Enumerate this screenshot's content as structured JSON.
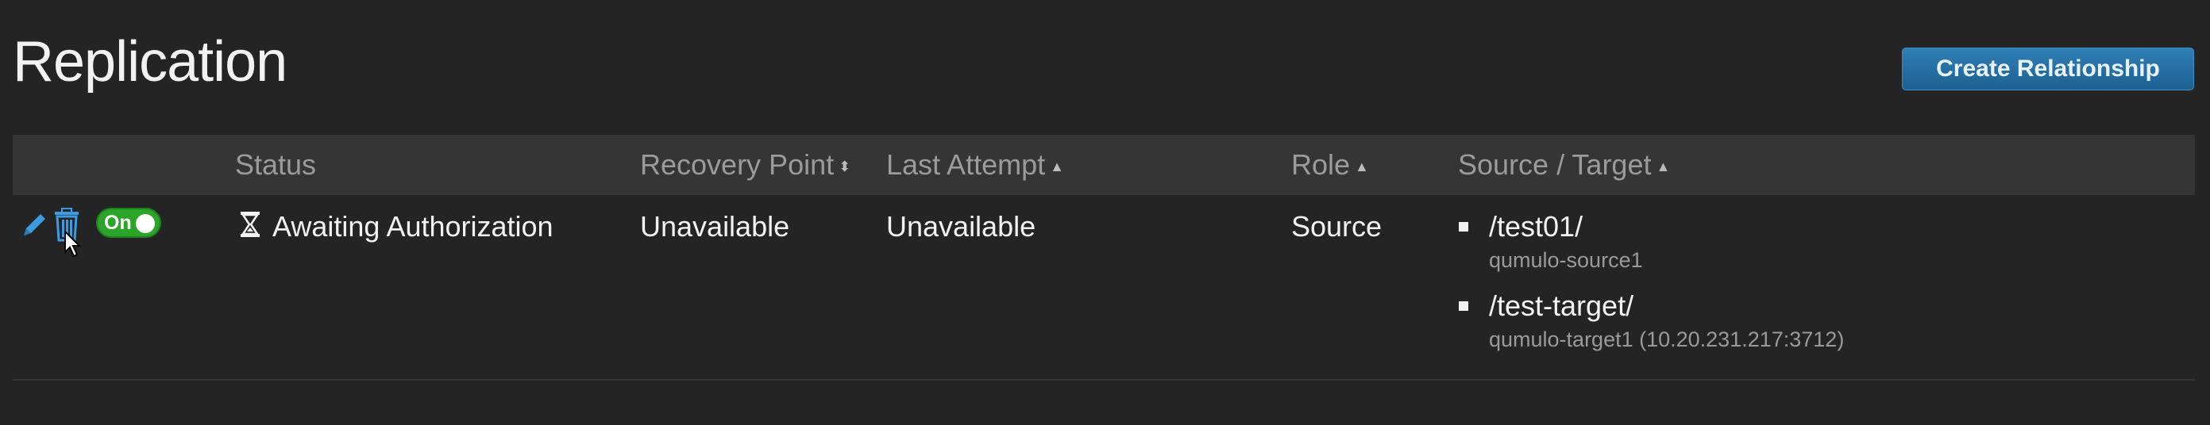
{
  "page": {
    "title": "Replication"
  },
  "header_actions": {
    "create_label": "Create Relationship"
  },
  "table": {
    "columns": {
      "status": "Status",
      "recovery_point": "Recovery Point",
      "last_attempt": "Last Attempt",
      "role": "Role",
      "source_target": "Source / Target"
    },
    "sort_indicators": {
      "recovery_point": "⬍",
      "last_attempt": "▲",
      "role": "▲",
      "source_target": "▲"
    },
    "rows": [
      {
        "toggle_label": "On",
        "status": "Awaiting Authorization",
        "status_icon": "hourglass-icon",
        "recovery_point": "Unavailable",
        "last_attempt": "Unavailable",
        "role": "Source",
        "source": {
          "path": "/test01/",
          "host": "qumulo-source1"
        },
        "target": {
          "path": "/test-target/",
          "host": "qumulo-target1 (10.20.231.217:3712)"
        }
      }
    ]
  },
  "colors": {
    "accent": "#2f7fb5",
    "toggle_on": "#2aa52a",
    "icon_blue": "#3d9be0"
  }
}
